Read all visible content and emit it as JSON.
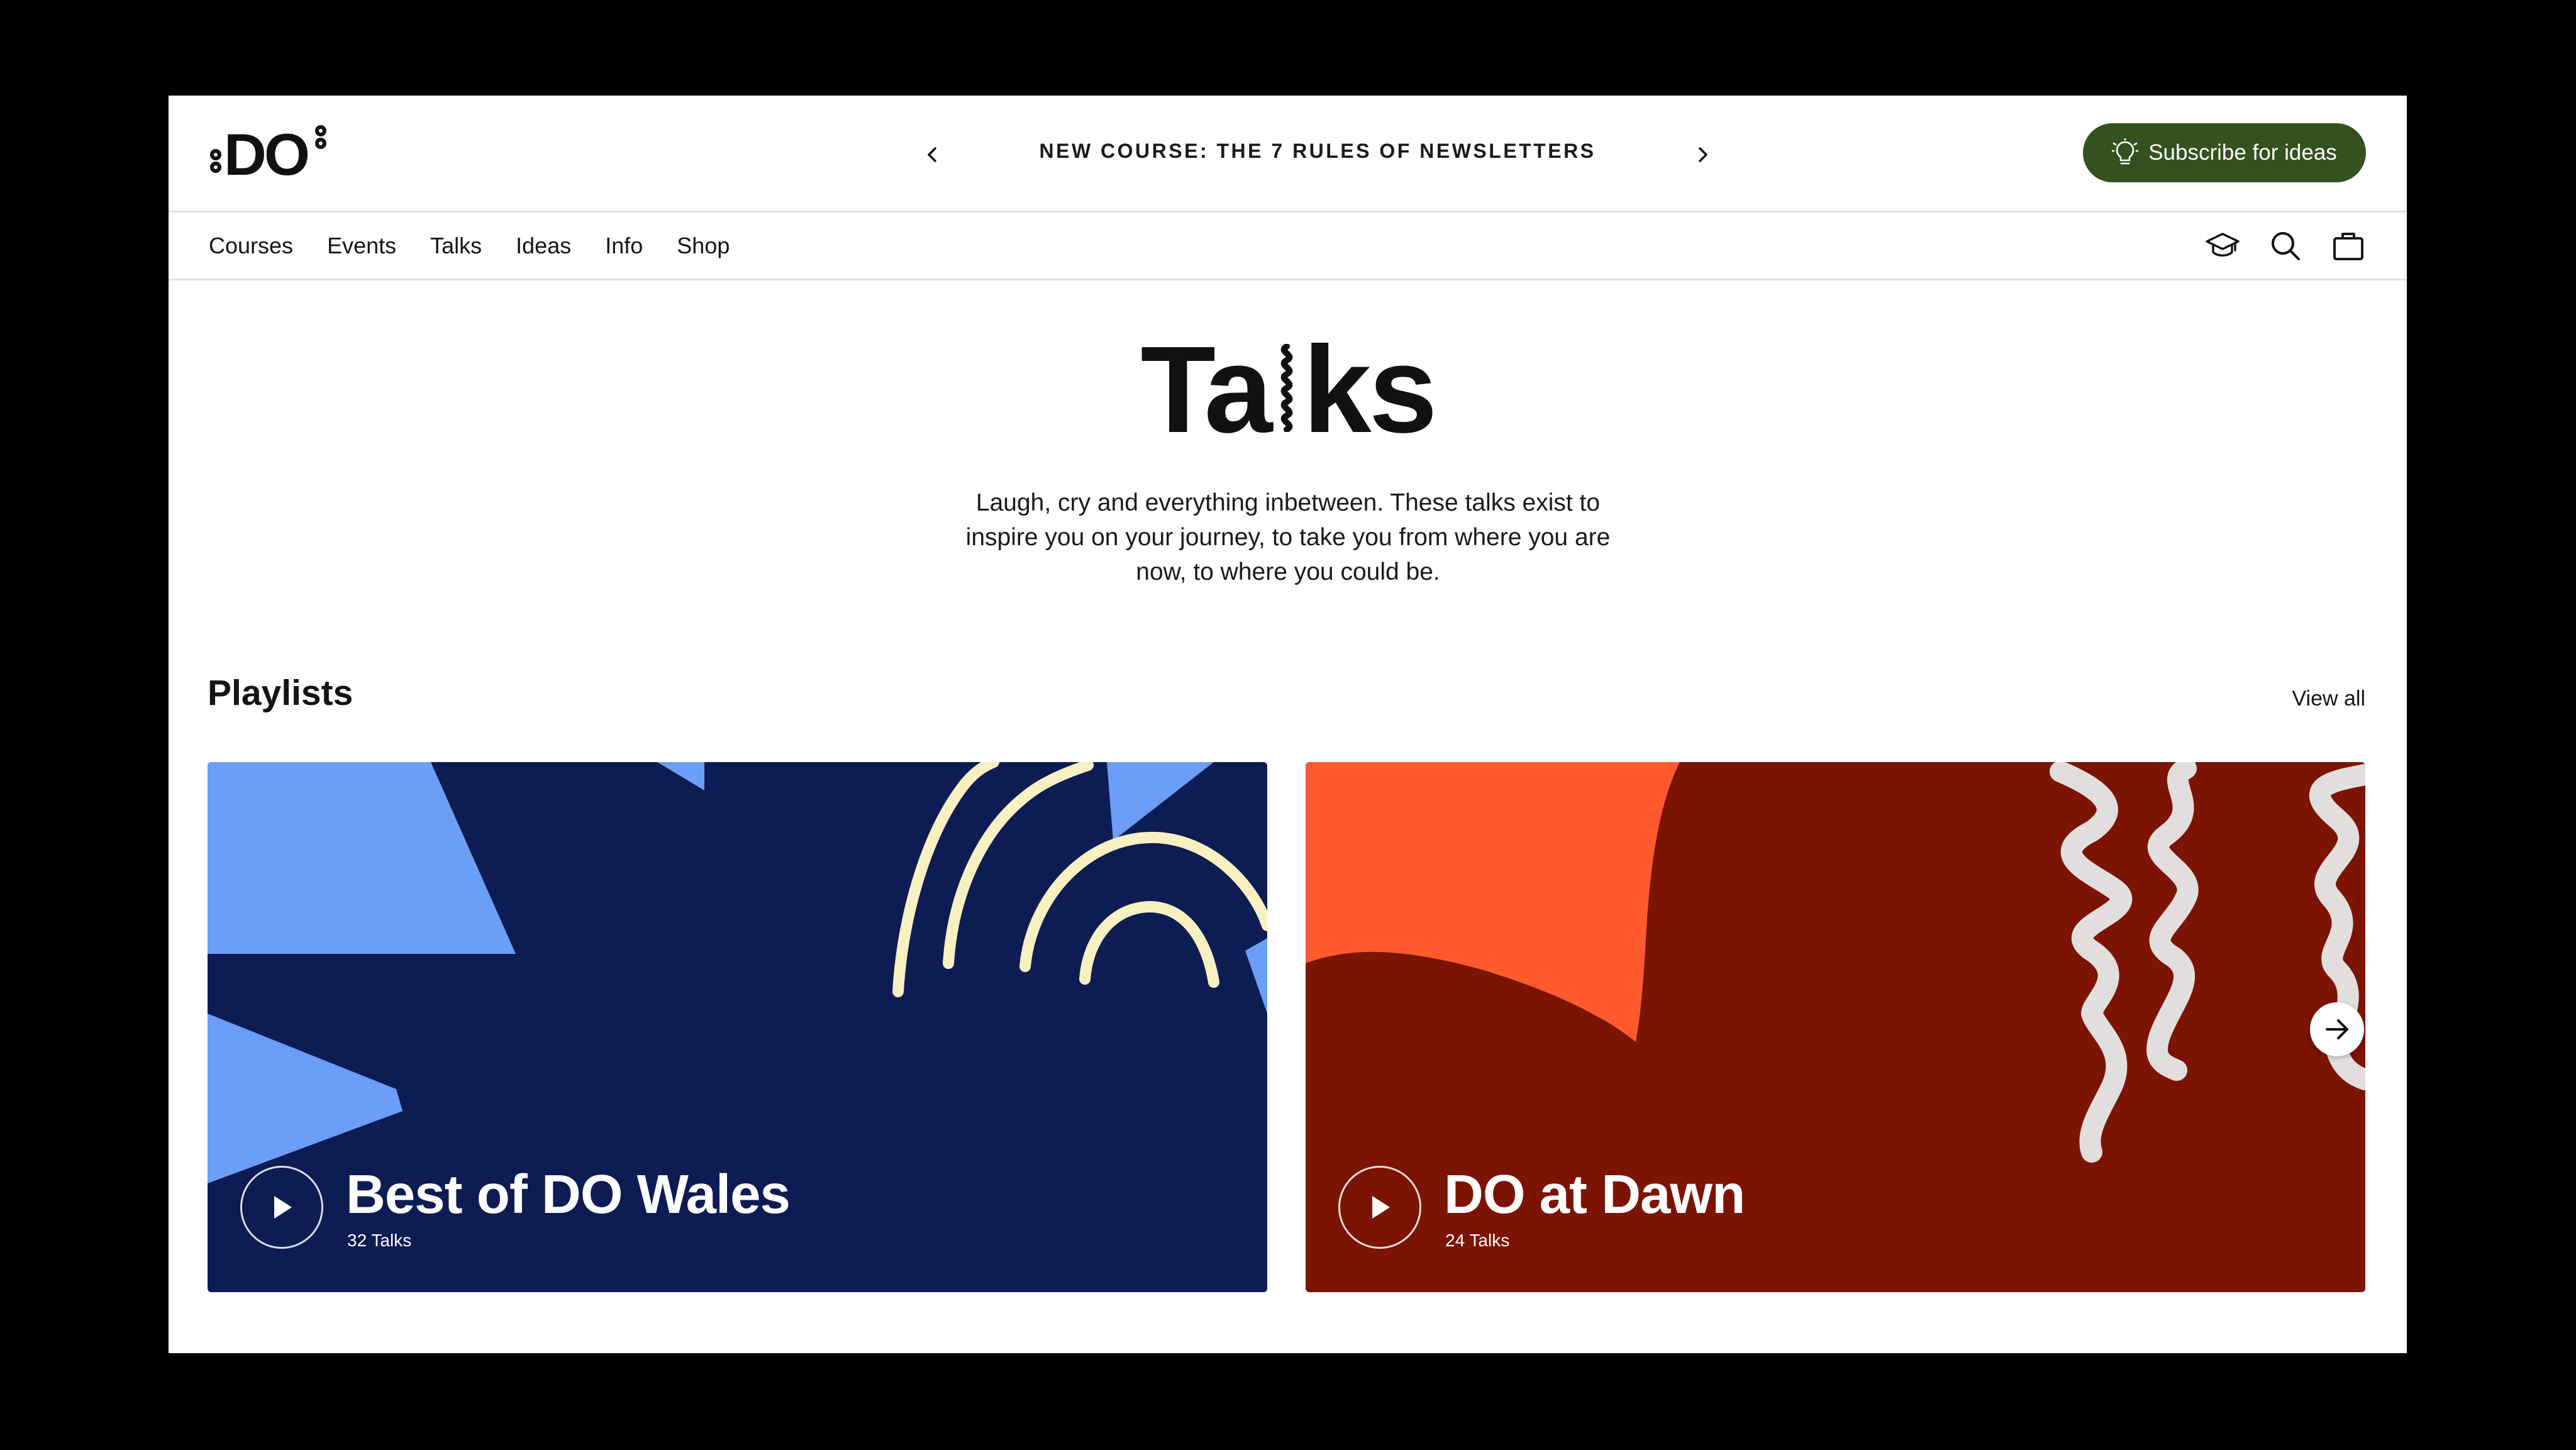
{
  "header": {
    "logo_text": "DO",
    "announcement": "NEW COURSE: THE 7 RULES OF NEWSLETTERS",
    "subscribe_label": "Subscribe for ideas",
    "subscribe_color": "#335220"
  },
  "nav": {
    "links": [
      "Courses",
      "Events",
      "Talks",
      "Ideas",
      "Info",
      "Shop"
    ],
    "icons": [
      "graduation-cap-icon",
      "search-icon",
      "bag-icon"
    ]
  },
  "hero": {
    "title_start": "Ta",
    "title_end": "ks",
    "description": "Laugh, cry and everything inbetween. These talks exist to inspire you on your journey, to take you from where you are now, to where you could be."
  },
  "playlists": {
    "heading": "Playlists",
    "view_all": "View all",
    "cards": [
      {
        "title": "Best of DO Wales",
        "count": "32 Talks",
        "bg_color": "#0e1c54",
        "accent_color": "#6b9ef7",
        "squiggle_color": "#f7f0c0"
      },
      {
        "title": "DO at Dawn",
        "count": "24 Talks",
        "bg_color": "#7c1404",
        "accent_color": "#ff5a2e",
        "squiggle_color": "#e2dede"
      }
    ]
  }
}
